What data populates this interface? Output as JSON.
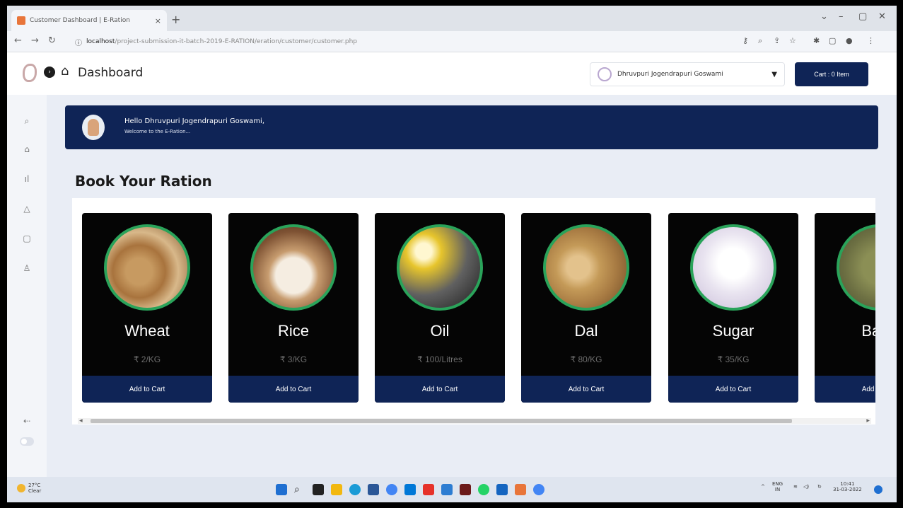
{
  "browser": {
    "tab_title": "Customer Dashboard | E-Ration",
    "tab_close": "×",
    "new_tab": "+",
    "url_host": "localhost",
    "url_path": "/project-submission-it-batch-2019-E-RATION/eration/customer/customer.php"
  },
  "header": {
    "title": "Dashboard",
    "user_name": "Dhruvpuri Jogendrapuri Goswami",
    "cart_label": "Cart : 0 Item"
  },
  "sidebar": {
    "icons": [
      "search-icon",
      "home-icon",
      "chart-icon",
      "bell-icon",
      "message-icon",
      "user-icon",
      "logout-icon"
    ]
  },
  "welcome": {
    "greeting": "Hello Dhruvpuri Jogendrapuri Goswami,",
    "message": "Welcome to the E-Ration..."
  },
  "section": {
    "title": "Book Your Ration"
  },
  "products": [
    {
      "name": "Wheat",
      "price": "₹ 2/KG",
      "button": "Add to Cart"
    },
    {
      "name": "Rice",
      "price": "₹ 3/KG",
      "button": "Add to Cart"
    },
    {
      "name": "Oil",
      "price": "₹ 100/Litres",
      "button": "Add to Cart"
    },
    {
      "name": "Dal",
      "price": "₹ 80/KG",
      "button": "Add to Cart"
    },
    {
      "name": "Sugar",
      "price": "₹ 35/KG",
      "button": "Add to Cart"
    },
    {
      "name": "Bajra",
      "price": "₹",
      "button": "Add to Cart"
    }
  ],
  "taskbar": {
    "weather_temp": "27°C",
    "weather_desc": "Clear",
    "lang": "ENG",
    "region": "IN",
    "time": "10:41",
    "date": "31-03-2022"
  }
}
